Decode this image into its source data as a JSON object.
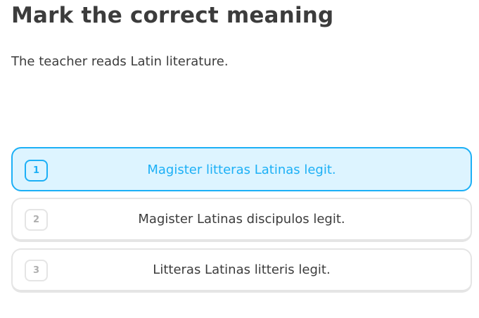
{
  "title": "Mark the correct meaning",
  "prompt": "The teacher reads Latin literature.",
  "options": [
    {
      "number": "1",
      "text": "Magister litteras Latinas legit.",
      "selected": true
    },
    {
      "number": "2",
      "text": "Magister Latinas discipulos legit.",
      "selected": false
    },
    {
      "number": "3",
      "text": "Litteras Latinas litteris legit.",
      "selected": false
    }
  ],
  "colors": {
    "text": "#3c3c3c",
    "selected_accent": "#1cb0f6",
    "selected_background": "#ddf4ff",
    "border": "#e5e5e5",
    "number_muted": "#afafaf"
  }
}
